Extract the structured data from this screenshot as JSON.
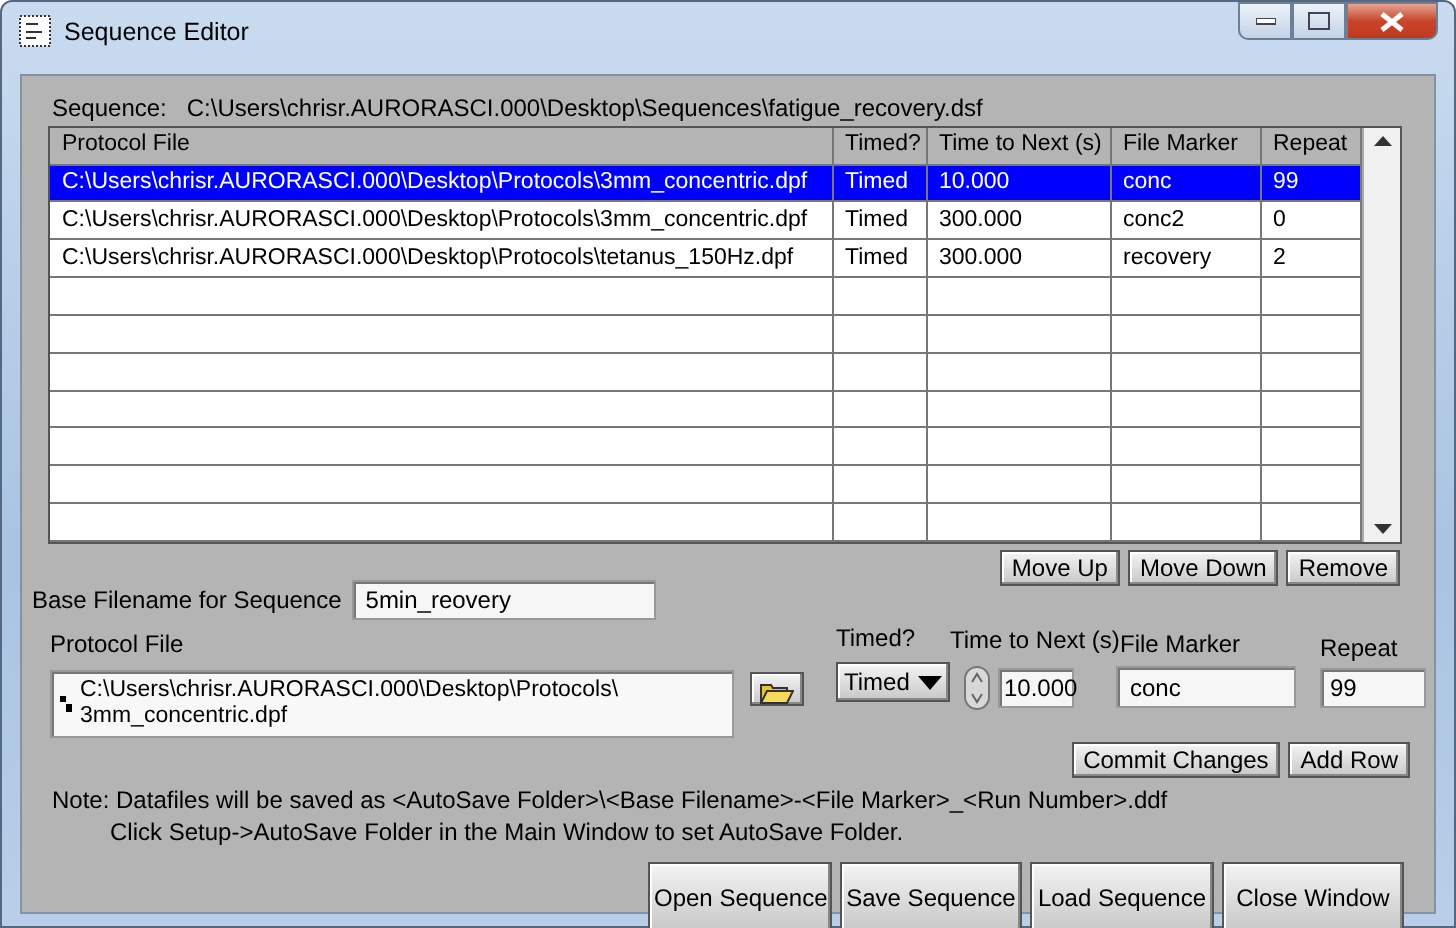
{
  "window": {
    "title": "Sequence Editor"
  },
  "sequence": {
    "label": "Sequence:",
    "path": "C:\\Users\\chrisr.AURORASCI.000\\Desktop\\Sequences\\fatigue_recovery.dsf"
  },
  "table": {
    "columns": [
      "Protocol File",
      "Timed?",
      "Time to Next (s)",
      "File Marker",
      "Repeat"
    ],
    "rows": [
      {
        "cells": [
          "C:\\Users\\chrisr.AURORASCI.000\\Desktop\\Protocols\\3mm_concentric.dpf",
          "Timed",
          "10.000",
          "conc",
          "99"
        ],
        "selected": true
      },
      {
        "cells": [
          "C:\\Users\\chrisr.AURORASCI.000\\Desktop\\Protocols\\3mm_concentric.dpf",
          "Timed",
          "300.000",
          "conc2",
          "0"
        ],
        "selected": false
      },
      {
        "cells": [
          "C:\\Users\\chrisr.AURORASCI.000\\Desktop\\Protocols\\tetanus_150Hz.dpf",
          "Timed",
          "300.000",
          "recovery",
          "2"
        ],
        "selected": false
      }
    ]
  },
  "row_buttons": [
    "Move Up",
    "Move Down",
    "Remove"
  ],
  "base_filename": {
    "label": "Base Filename for Sequence",
    "value": "5min_reovery"
  },
  "protocol_file": {
    "label": "Protocol File",
    "value_lines": [
      "C:\\Users\\chrisr.AURORASCI.000\\Desktop\\Protocols\\",
      "3mm_concentric.dpf"
    ]
  },
  "timed": {
    "label": "Timed?",
    "value": "Timed"
  },
  "time_to_next": {
    "label": "Time to Next (s)",
    "value": "10.000"
  },
  "file_marker": {
    "label": "File Marker",
    "value": "conc"
  },
  "repeat": {
    "label": "Repeat",
    "value": "99"
  },
  "edit_buttons": [
    "Commit Changes",
    "Add Row"
  ],
  "note": [
    "Note: Datafiles will be saved as <AutoSave Folder>\\<Base Filename>-<File Marker>_<Run Number>.ddf",
    "Click Setup->AutoSave Folder in the Main Window to set AutoSave Folder."
  ],
  "bottom_buttons": [
    "Open Sequence",
    "Save Sequence",
    "Load Sequence",
    "Close Window"
  ]
}
